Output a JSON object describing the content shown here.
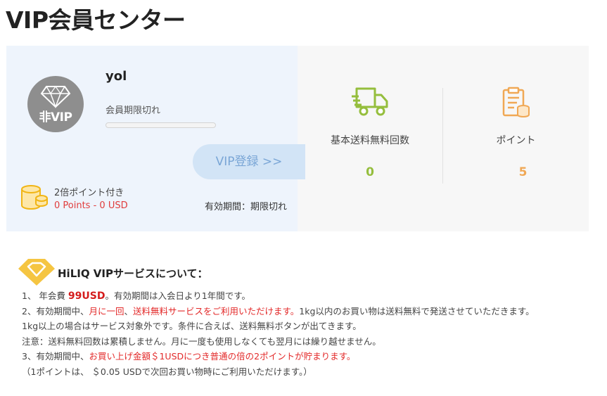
{
  "page": {
    "title": "VIP会員センター"
  },
  "profile": {
    "username": "yol",
    "membership_status": "会員期限切れ",
    "badge_text": "非VIP",
    "vip_button_label": "VIP登録 >>",
    "points_title": "2倍ポイント付き",
    "points_value": "0 Points - 0 USD",
    "validity": "有効期間：期限切れ",
    "progress_fraction": 0
  },
  "stats": {
    "free_shipping": {
      "label": "基本送料無料回数",
      "value": "0",
      "icon": "truck-icon"
    },
    "points": {
      "label": "ポイント",
      "value": "5",
      "icon": "clipboard-coins-icon"
    }
  },
  "service": {
    "title": "HiLIQ VIPサービスについて：",
    "line1_prefix": "1、 年会費",
    "line1_fee": "99USD",
    "line1_suffix": "。有効期間は入会日より1年間です。",
    "line2_prefix": "2、有効期間中、",
    "line2_red1": "月に一回",
    "line2_sep": "、",
    "line2_red2": "送料無料サービスをご利用いただけます。",
    "line2_suffix": "1kg以内のお買い物は送料無料で発送させていただきます。",
    "line3": "1kg以上の場合はサービス対象外です。条件に合えば、送料無料ボタンが出てきます。",
    "line4": "注意：送料無料回数は累積しません。月に一度も使用しなくても翌月には繰り越せません。",
    "line5_prefix": "3、有効期間中、",
    "line5_red": "お買い上げ金額＄1USDにつき普通の倍の2ポイントが貯まります。",
    "line6": "（1ポイントは、 ＄0.05 USDで次回お買い物時にご利用いただけます。）"
  },
  "colors": {
    "accent_blue": "#3d8bd8",
    "shipping_green": "#95be3d",
    "points_orange": "#f0a855",
    "badge_yellow": "#f5c542",
    "highlight_red": "#e32a2a"
  }
}
